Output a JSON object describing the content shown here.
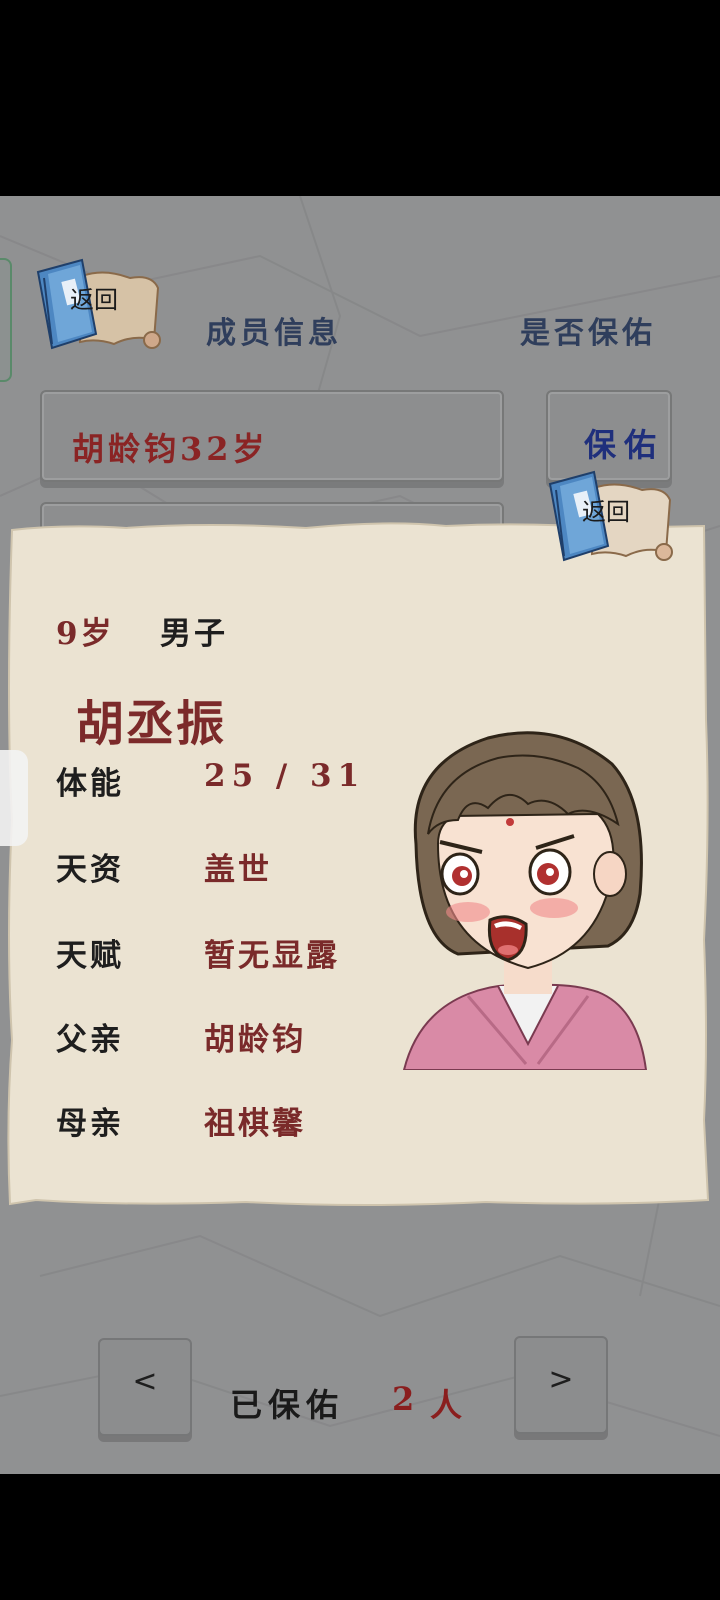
{
  "header": {
    "back_label": "返回",
    "member_info": "成员信息",
    "bless_question": "是否保佑"
  },
  "member_row": {
    "name_age": "胡龄钧32岁",
    "bless_button": "保佑"
  },
  "detail_card": {
    "back_label": "返回",
    "age": "9岁",
    "gender": "男子",
    "name": "胡丞振",
    "stats": [
      {
        "label": "体能",
        "value": "25 / 31"
      },
      {
        "label": "天资",
        "value": "盖世"
      },
      {
        "label": "天赋",
        "value": "暂无显露"
      },
      {
        "label": "父亲",
        "value": "胡龄钧"
      },
      {
        "label": "母亲",
        "value": "祖棋馨"
      }
    ]
  },
  "footer": {
    "prev": "<",
    "next": ">",
    "blessed_label": "已保佑",
    "blessed_count": "2",
    "unit": "人"
  },
  "colors": {
    "accent_red": "#7a2a2a",
    "accent_blue": "#1f2f7c",
    "paper": "#ebe3d2",
    "background": "#909192"
  }
}
